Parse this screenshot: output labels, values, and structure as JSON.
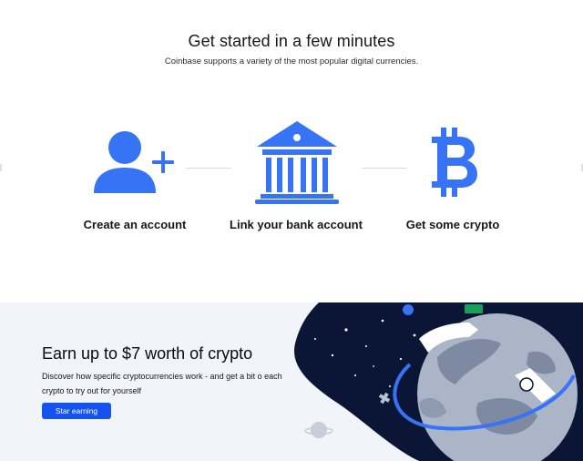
{
  "header": {
    "title": "Get started in a few minutes",
    "subtitle": "Coinbase supports a variety of the most popular digital currencies."
  },
  "steps": [
    {
      "label": "Create an account",
      "icon": "add-user-icon"
    },
    {
      "label": "Link your bank account",
      "icon": "bank-icon"
    },
    {
      "label": "Get some crypto",
      "icon": "bitcoin-icon"
    }
  ],
  "promo": {
    "title": "Earn up to $7 worth of crypto",
    "description": "Discover how specific cryptocurrencies work - and get a bit o each crypto to try out for yourself",
    "button_label": "Star earning",
    "illustration": "space-planet-illustration"
  },
  "colors": {
    "accent": "#1652f0",
    "icon_blue": "#3773f5",
    "promo_bg": "#f1f4f9",
    "space_bg": "#0b1536"
  }
}
